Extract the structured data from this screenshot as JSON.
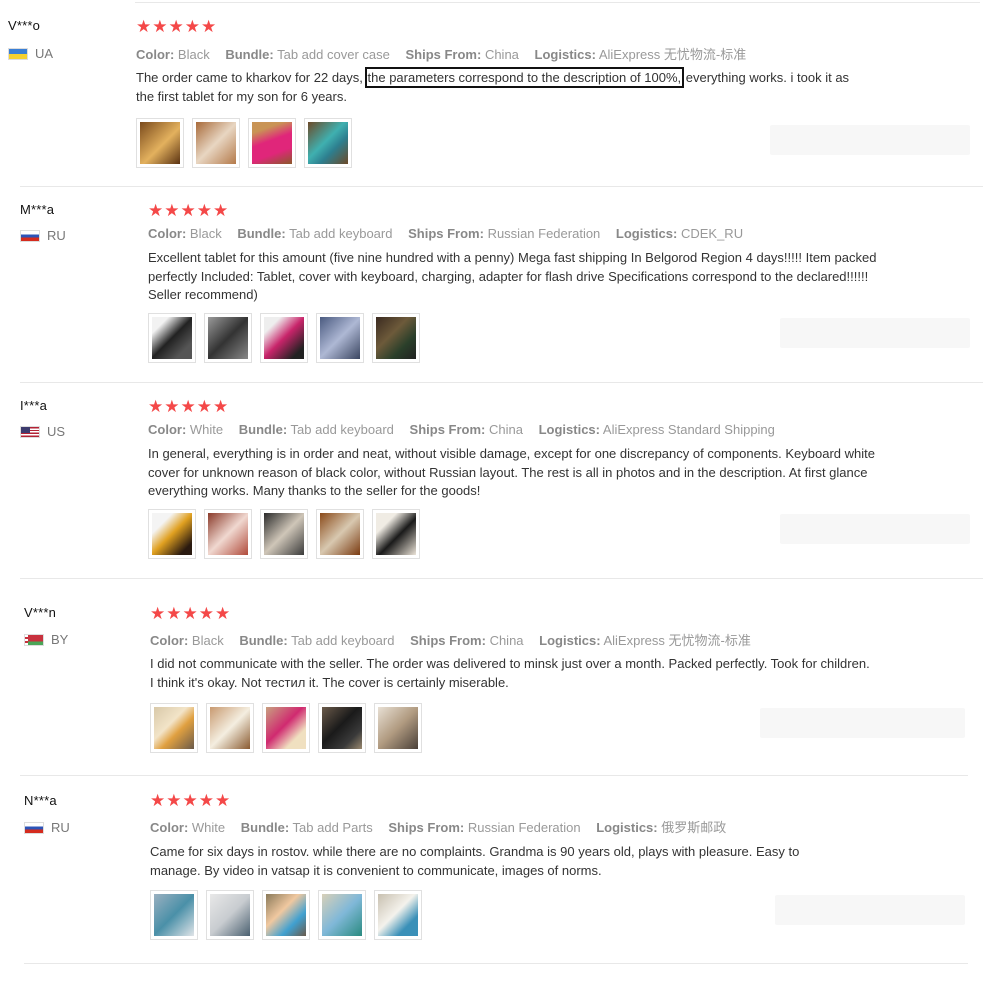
{
  "labels": {
    "color": "Color:",
    "bundle": "Bundle:",
    "ships_from": "Ships From:",
    "logistics": "Logistics:"
  },
  "reviews": [
    {
      "user": "V***o",
      "country": "UA",
      "stars": "★★★★★",
      "color": "Black",
      "bundle": "Tab add cover case",
      "ships_from": "China",
      "logistics": "AliExpress 无忧物流-标准",
      "text_before": "The order came to kharkov for 22 days,",
      "text_highlight": "the parameters correspond to the description of 100%,",
      "text_after": "everything works. i took it as the first tablet for my son for 6 years."
    },
    {
      "user": "M***a",
      "country": "RU",
      "stars": "★★★★★",
      "color": "Black",
      "bundle": "Tab add keyboard",
      "ships_from": "Russian Federation",
      "logistics": "CDEK_RU",
      "text": "Excellent tablet for this amount (five nine hundred with a penny) Mega fast shipping In Belgorod Region 4 days!!!!! Item packed perfectly Included: Tablet, cover with keyboard, charging, adapter for flash drive Specifications correspond to the declared!!!!!! Seller recommend)"
    },
    {
      "user": "I***a",
      "country": "US",
      "stars": "★★★★★",
      "color": "White",
      "bundle": "Tab add keyboard",
      "ships_from": "China",
      "logistics": "AliExpress Standard Shipping",
      "text": "In general, everything is in order and neat, without visible damage, except for one discrepancy of components. Keyboard white cover for unknown reason of black color, without Russian layout. The rest is all in photos and in the description. At first glance everything works. Many thanks to the seller for the goods!"
    },
    {
      "user": "V***n",
      "country": "BY",
      "stars": "★★★★★",
      "color": "Black",
      "bundle": "Tab add keyboard",
      "ships_from": "China",
      "logistics": "AliExpress 无忧物流-标准",
      "text": "I did not communicate with the seller. The order was delivered to minsk just over a month. Packed perfectly. Took for children. I think it's okay. Not тестил it. The cover is certainly miserable."
    },
    {
      "user": "N***a",
      "country": "RU",
      "stars": "★★★★★",
      "color": "White",
      "bundle": "Tab add Parts",
      "ships_from": "Russian Federation",
      "logistics": "俄罗斯邮政",
      "text": "Came for six days in rostov. while there are no complaints. Grandma is 90 years old, plays with pleasure. Easy to manage. By video in vatsap it is convenient to communicate, images of norms."
    }
  ]
}
